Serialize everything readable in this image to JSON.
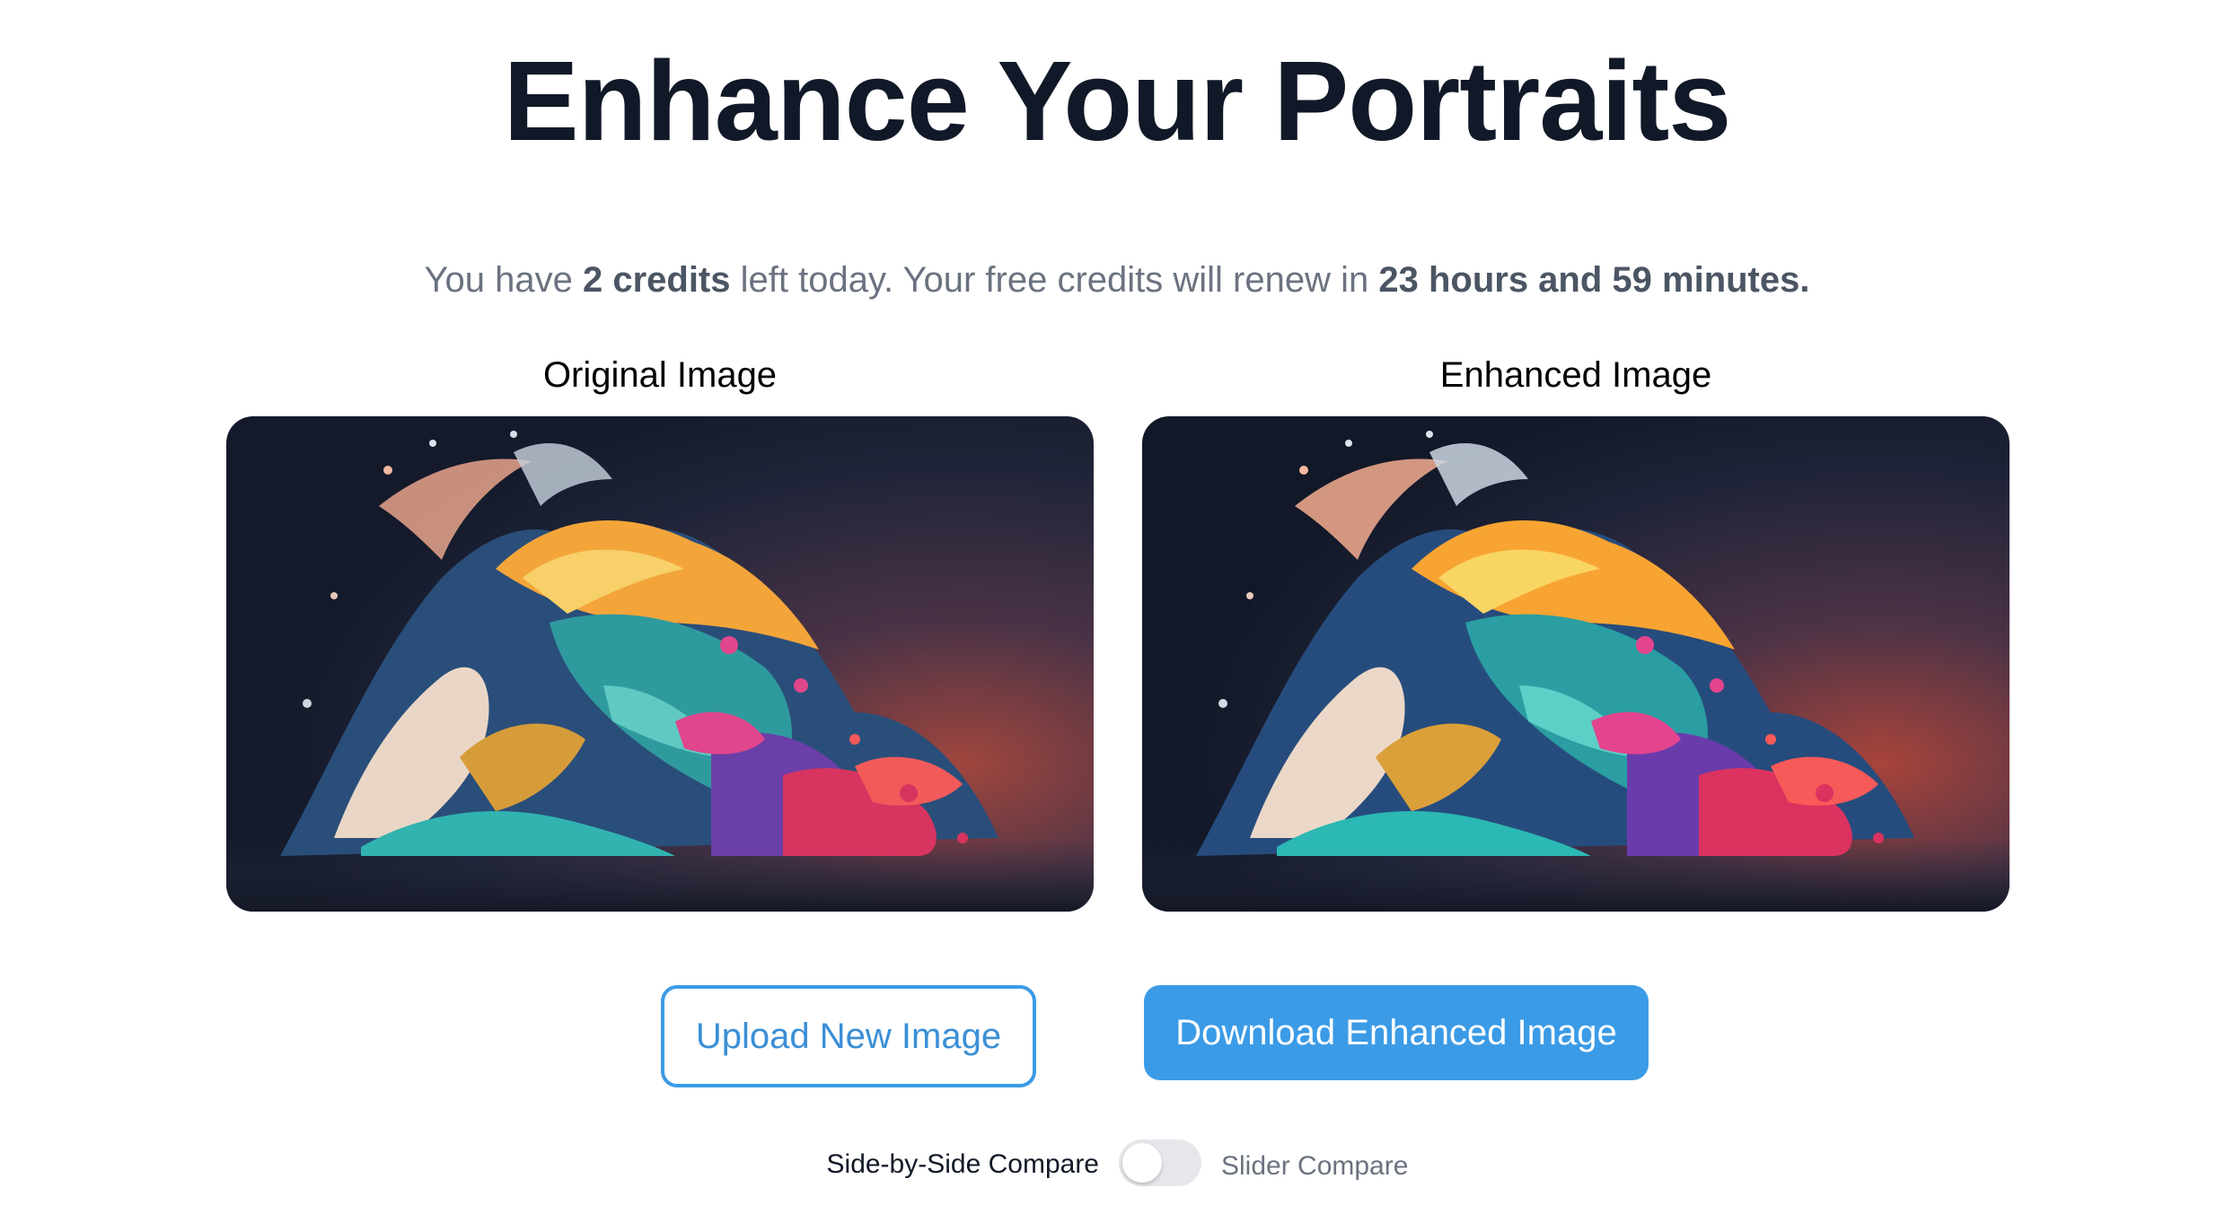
{
  "page": {
    "title": "Enhance Your Portraits"
  },
  "credits": {
    "prefix": "You have ",
    "count": "2 credits",
    "middle": " left today. Your free credits will renew in ",
    "renew_time": "23 hours and 59 minutes."
  },
  "panels": {
    "original_label": "Original Image",
    "enhanced_label": "Enhanced Image"
  },
  "buttons": {
    "upload_label": "Upload New Image",
    "download_label": "Download Enhanced Image"
  },
  "compare": {
    "left_label": "Side-by-Side Compare",
    "right_label": "Slider Compare",
    "slider_enabled": false
  },
  "colors": {
    "accent": "#3b9be6",
    "title": "#111827",
    "muted": "#6b7280"
  }
}
